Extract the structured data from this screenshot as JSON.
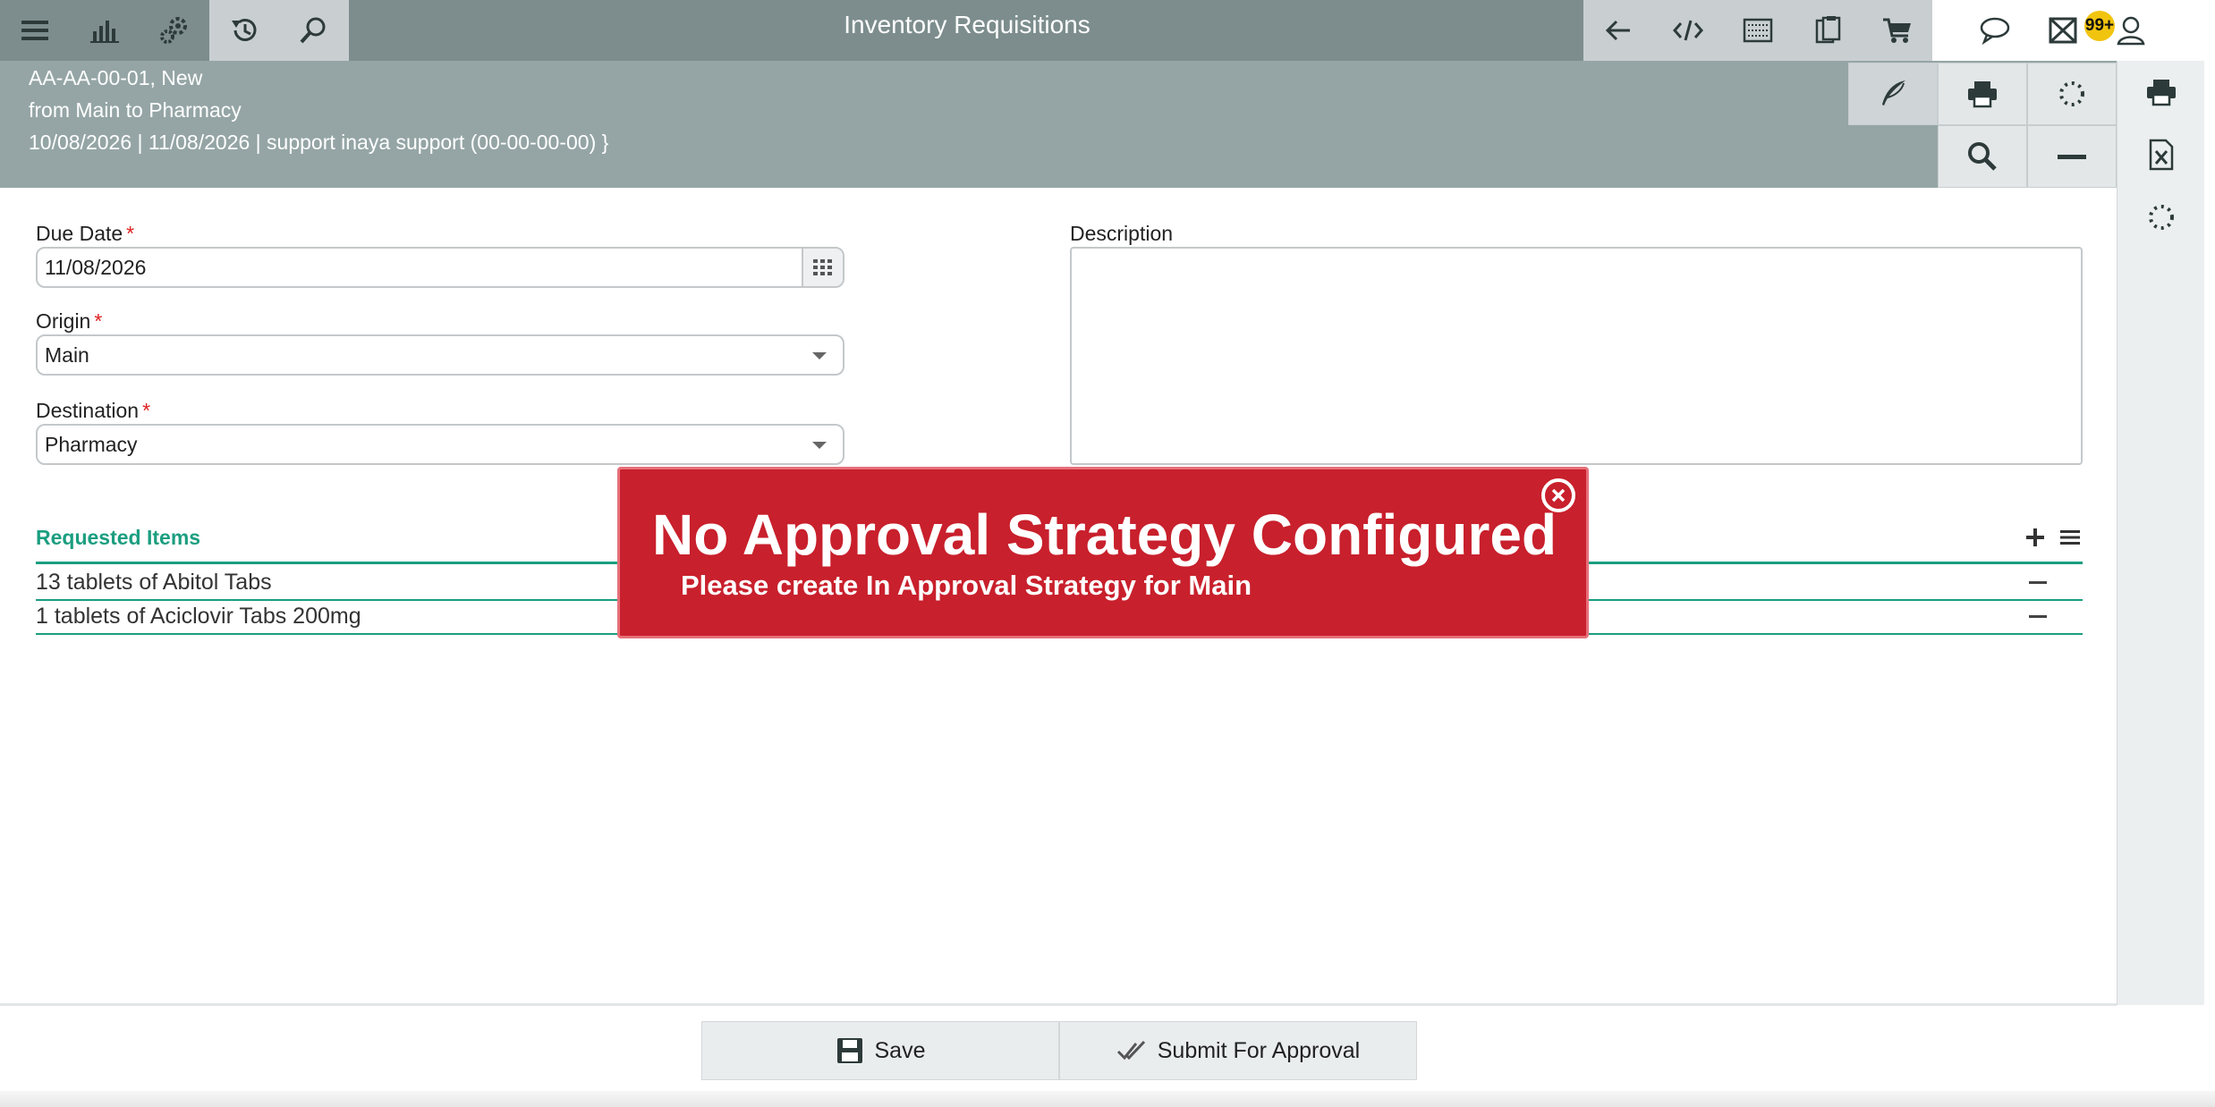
{
  "app": {
    "title": "Inventory Requisitions"
  },
  "notifications": {
    "mail_count": "99+"
  },
  "header": {
    "line1": "AA-AA-00-01, New",
    "line2": "from Main to Pharmacy",
    "line3": "10/08/2026 | 11/08/2026 | support inaya support (00-00-00-00) }"
  },
  "form": {
    "due_date": {
      "label": "Due Date",
      "value": "11/08/2026"
    },
    "origin": {
      "label": "Origin",
      "value": "Main"
    },
    "destination": {
      "label": "Destination",
      "value": "Pharmacy"
    },
    "description": {
      "label": "Description",
      "value": ""
    },
    "required_mark": "*"
  },
  "requested_items": {
    "title": "Requested Items",
    "items": [
      {
        "label": "13 tablets of Abitol Tabs"
      },
      {
        "label": "1 tablets of Aciclovir Tabs 200mg"
      }
    ]
  },
  "footer": {
    "save_label": "Save",
    "submit_label": "Submit For Approval"
  },
  "alert": {
    "title": "No Approval Strategy Configured",
    "message": "Please create In Approval Strategy for Main"
  },
  "colors": {
    "accent": "#1b9e80",
    "alert": "#c8202c",
    "topbar": "#7d8d8d",
    "header": "#95a5a5"
  }
}
